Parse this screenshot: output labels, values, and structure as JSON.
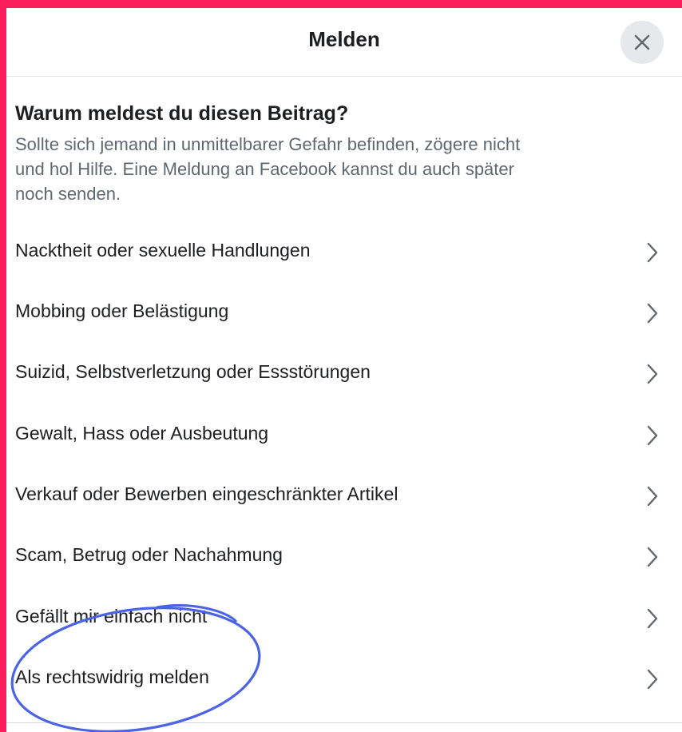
{
  "dialog": {
    "title": "Melden",
    "close_icon": "close-icon"
  },
  "intro": {
    "heading": "Warum meldest du diesen Beitrag?",
    "text_line1": "Sollte sich jemand in unmittelbarer Gefahr befinden, zögere nicht",
    "text_line2": "und hol Hilfe. Eine Meldung an Facebook kannst du auch später",
    "text_line3": "noch senden."
  },
  "options": [
    {
      "label": "Nacktheit oder sexuelle Handlungen"
    },
    {
      "label": "Mobbing oder Belästigung"
    },
    {
      "label": "Suizid, Selbstverletzung oder Essstörungen"
    },
    {
      "label": "Gewalt, Hass oder Ausbeutung"
    },
    {
      "label": "Verkauf oder Bewerben eingeschränkter Artikel"
    },
    {
      "label": "Scam, Betrug oder Nachahmung"
    },
    {
      "label": "Gefällt mir einfach nicht"
    },
    {
      "label": "Als rechtswidrig melden"
    }
  ],
  "colors": {
    "frame": "#fb1c5c",
    "annotation_circle": "#4a63e7",
    "text_primary": "#1c1e21",
    "text_secondary": "#606770"
  },
  "icons": {
    "chevron": "chevron-right-icon",
    "close": "close-icon"
  }
}
